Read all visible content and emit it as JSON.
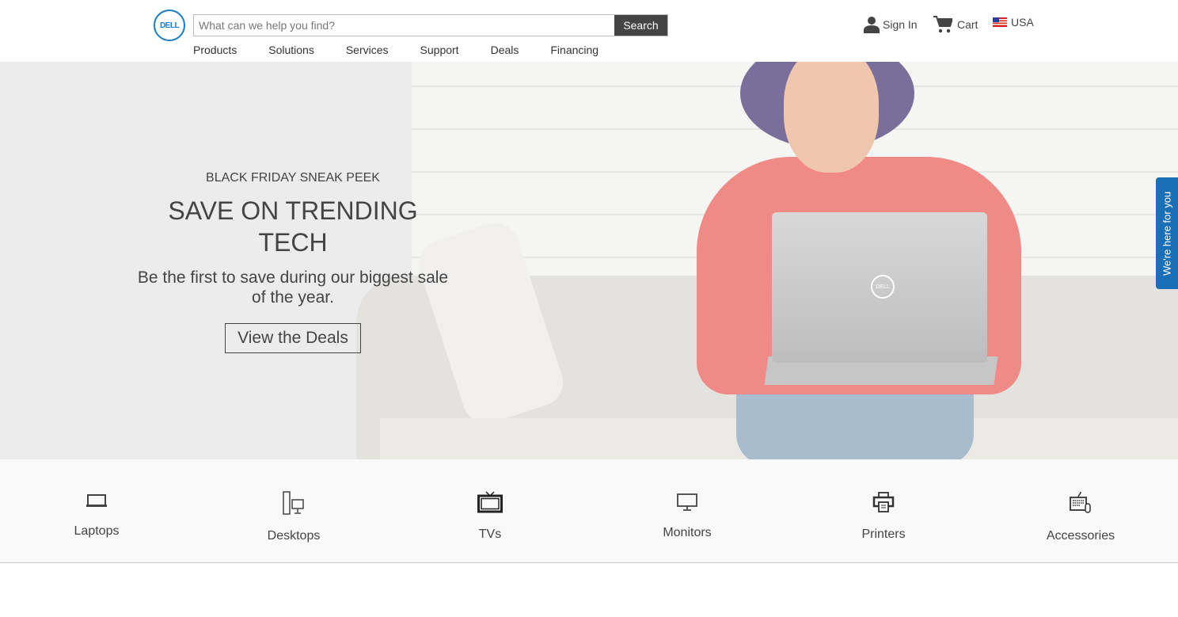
{
  "header": {
    "logo": "DELL",
    "search_placeholder": "What can we help you find?",
    "search_label": "Search",
    "nav": [
      "Products",
      "Solutions",
      "Services",
      "Support",
      "Deals",
      "Financing"
    ],
    "sign_in": "Sign In",
    "cart": "Cart",
    "country": "USA"
  },
  "hero": {
    "eyebrow": "BLACK FRIDAY SNEAK PEEK",
    "title": "SAVE ON TRENDING TECH",
    "subtitle": "Be the first to save during our biggest sale of the year.",
    "cta": "View the Deals",
    "laptop_logo": "DELL"
  },
  "chat": "We're here for you",
  "categories": [
    {
      "label": "Laptops"
    },
    {
      "label": "Desktops"
    },
    {
      "label": "TVs"
    },
    {
      "label": "Monitors"
    },
    {
      "label": "Printers"
    },
    {
      "label": "Accessories"
    }
  ],
  "colors": {
    "brand": "#1a7bc9",
    "search_button": "#444444",
    "chat": "#1a6fb6"
  }
}
